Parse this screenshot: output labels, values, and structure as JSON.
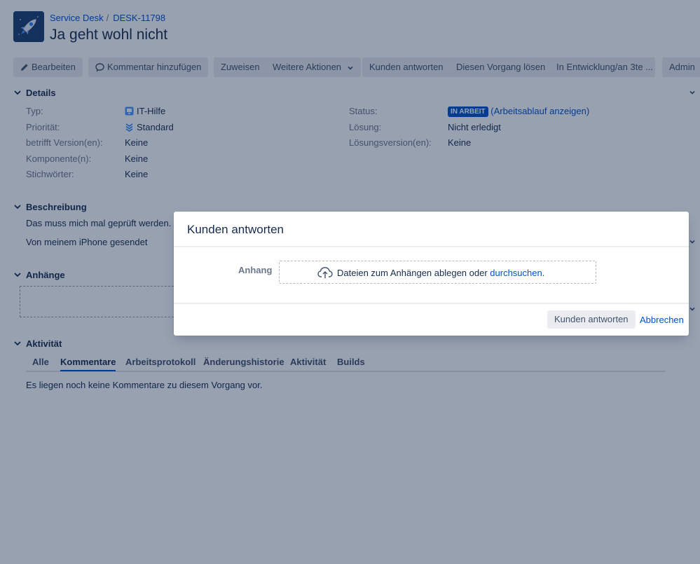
{
  "header": {
    "breadcrumb_project": "Service Desk",
    "breadcrumb_sep": "/",
    "breadcrumb_issue": "DESK-11798",
    "title": "Ja geht wohl nicht"
  },
  "toolbar": {
    "edit": "Bearbeiten",
    "comment": "Kommentar hinzufügen",
    "assign": "Zuweisen",
    "more": "Weitere Aktionen",
    "reply": "Kunden antworten",
    "resolve": "Diesen Vorgang lösen",
    "workflow": "In Entwicklung/an 3te ...",
    "admin": "Admin"
  },
  "details": {
    "heading": "Details",
    "type_label": "Typ:",
    "type_value": "IT-Hilfe",
    "priority_label": "Priorität:",
    "priority_value": "Standard",
    "affects_label": "betrifft Version(en):",
    "affects_value": "Keine",
    "components_label": "Komponente(n):",
    "components_value": "Keine",
    "labels_label": "Stichwörter:",
    "labels_value": "Keine",
    "status_label": "Status:",
    "status_value": "IN ARBEIT",
    "workflow_open": "(",
    "workflow_link": "Arbeitsablauf anzeigen",
    "workflow_close": ")",
    "resolution_label": "Lösung:",
    "resolution_value": "Nicht erledigt",
    "fixversion_label": "Lösungsversion(en):",
    "fixversion_value": "Keine"
  },
  "description": {
    "heading": "Beschreibung",
    "line1": "Das muss mich mal geprüft werden. S",
    "line2": "Von meinem iPhone gesendet"
  },
  "attachments": {
    "heading": "Anhänge"
  },
  "activity": {
    "heading": "Aktivität",
    "tabs": [
      "Alle",
      "Kommentare",
      "Arbeitsprotokoll",
      "Änderungshistorie",
      "Aktivität",
      "Builds"
    ],
    "active_tab": "Kommentare",
    "empty_text": "Es liegen noch keine Kommentare zu diesem Vorgang vor."
  },
  "dialog": {
    "title": "Kunden antworten",
    "attachment_label": "Anhang",
    "drop_text": "Dateien zum Anhängen ablegen oder ",
    "browse_link": "durchsuchen",
    "browse_suffix": ".",
    "submit": "Kunden antworten",
    "cancel": "Abbrechen"
  },
  "colors": {
    "link": "#0052cc",
    "status_badge": "#0052cc",
    "overlay": "rgba(9,30,66,0.42)"
  },
  "icons": {
    "logo": "rocket-icon",
    "edit": "pencil-icon",
    "comment": "speech-bubble-icon",
    "more": "chevron-down-icon",
    "type": "it-help-icon",
    "priority": "priority-standard-icon",
    "upload": "cloud-upload-icon"
  }
}
